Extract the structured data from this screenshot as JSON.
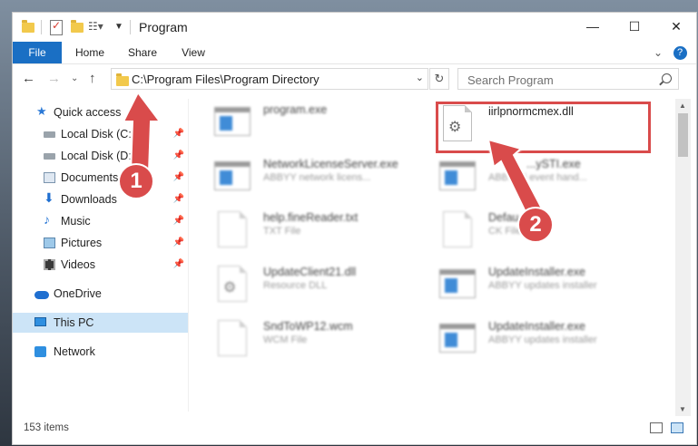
{
  "window": {
    "title": "Program",
    "controls": {
      "minimize": "—",
      "maximize": "☐",
      "close": "✕"
    }
  },
  "ribbon": {
    "tabs": [
      "File",
      "Home",
      "Share",
      "View"
    ],
    "expand_glyph": "⌄",
    "help_glyph": "?"
  },
  "address": {
    "path": "C:\\Program Files\\Program Directory",
    "search_placeholder": "Search Program"
  },
  "nav": {
    "quick_access": "Quick access",
    "items": [
      {
        "label": "Local Disk (C:)",
        "icon": "disk-icon"
      },
      {
        "label": "Local Disk (D:)",
        "icon": "disk-icon"
      },
      {
        "label": "Documents",
        "icon": "documents-icon"
      },
      {
        "label": "Downloads",
        "icon": "downloads-icon"
      },
      {
        "label": "Music",
        "icon": "music-icon"
      },
      {
        "label": "Pictures",
        "icon": "pictures-icon"
      },
      {
        "label": "Videos",
        "icon": "videos-icon"
      }
    ],
    "onedrive": "OneDrive",
    "this_pc": "This PC",
    "network": "Network"
  },
  "files": [
    {
      "name": "program.exe",
      "desc": "",
      "type": "exe"
    },
    {
      "name": "iirlpnormcmex.dll",
      "desc": "",
      "type": "dll"
    },
    {
      "name": "NetworkLicenseServer.exe",
      "desc": "ABBYY network licens...",
      "type": "exe"
    },
    {
      "name": "...ySTI.exe",
      "desc": "ABB...sti event hand...",
      "type": "exe"
    },
    {
      "name": "help.fineReader.txt",
      "desc": "TXT File",
      "type": "doc"
    },
    {
      "name": "Defau...ck",
      "desc": "CK File",
      "type": "doc"
    },
    {
      "name": "UpdateClient21.dll",
      "desc": "Resource DLL",
      "type": "dll"
    },
    {
      "name": "UpdateInstaller.exe",
      "desc": "ABBYY updates installer",
      "type": "exe"
    },
    {
      "name": "SndToWP12.wcm",
      "desc": "WCM File",
      "type": "doc"
    },
    {
      "name": "UpdateInstaller.exe",
      "desc": "ABBYY updates installer",
      "type": "exe"
    }
  ],
  "status": {
    "count": "153 items"
  },
  "annotations": {
    "step1": "1",
    "step2": "2",
    "color": "#d94b4b"
  }
}
